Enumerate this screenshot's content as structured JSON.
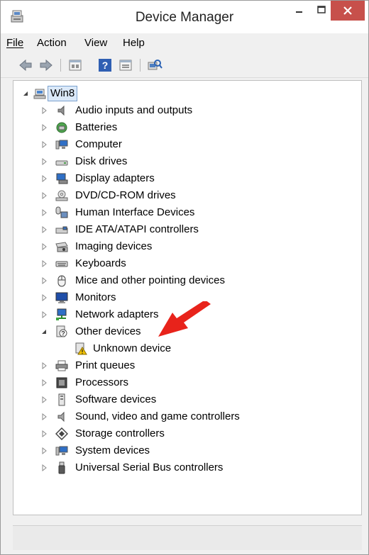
{
  "window": {
    "title": "Device Manager",
    "buttons": [
      "minimize",
      "maximize",
      "close"
    ]
  },
  "menu": [
    {
      "label": "File",
      "accel": "F"
    },
    {
      "label": "Action",
      "accel": "A"
    },
    {
      "label": "View",
      "accel": "V"
    },
    {
      "label": "Help",
      "accel": "H"
    }
  ],
  "toolbar": {
    "icons": [
      "back-arrow-icon",
      "forward-arrow-icon",
      "properties-icon",
      "help-icon",
      "device-view-icon",
      "scan-hardware-icon"
    ]
  },
  "tree": {
    "root": {
      "label": "Win8",
      "icon": "computer-icon",
      "expanded": true,
      "selected": true
    },
    "items": [
      {
        "label": "Audio inputs and outputs",
        "icon": "speaker-icon",
        "expanded": false
      },
      {
        "label": "Batteries",
        "icon": "battery-icon",
        "expanded": false
      },
      {
        "label": "Computer",
        "icon": "computer-icon",
        "expanded": false
      },
      {
        "label": "Disk drives",
        "icon": "disk-drive-icon",
        "expanded": false
      },
      {
        "label": "Display adapters",
        "icon": "display-adapter-icon",
        "expanded": false
      },
      {
        "label": "DVD/CD-ROM drives",
        "icon": "dvd-drive-icon",
        "expanded": false
      },
      {
        "label": "Human Interface Devices",
        "icon": "hid-icon",
        "expanded": false
      },
      {
        "label": "IDE ATA/ATAPI controllers",
        "icon": "ide-controller-icon",
        "expanded": false
      },
      {
        "label": "Imaging devices",
        "icon": "camera-icon",
        "expanded": false
      },
      {
        "label": "Keyboards",
        "icon": "keyboard-icon",
        "expanded": false
      },
      {
        "label": "Mice and other pointing devices",
        "icon": "mouse-icon",
        "expanded": false
      },
      {
        "label": "Monitors",
        "icon": "monitor-icon",
        "expanded": false
      },
      {
        "label": "Network adapters",
        "icon": "network-adapter-icon",
        "expanded": false
      },
      {
        "label": "Other devices",
        "icon": "other-devices-icon",
        "expanded": true,
        "children": [
          {
            "label": "Unknown device",
            "icon": "unknown-device-warning-icon"
          }
        ]
      },
      {
        "label": "Print queues",
        "icon": "printer-icon",
        "expanded": false
      },
      {
        "label": "Processors",
        "icon": "processor-icon",
        "expanded": false
      },
      {
        "label": "Software devices",
        "icon": "software-device-icon",
        "expanded": false
      },
      {
        "label": "Sound, video and game controllers",
        "icon": "sound-controller-icon",
        "expanded": false
      },
      {
        "label": "Storage controllers",
        "icon": "storage-controller-icon",
        "expanded": false
      },
      {
        "label": "System devices",
        "icon": "system-devices-icon",
        "expanded": false
      },
      {
        "label": "Universal Serial Bus controllers",
        "icon": "usb-icon",
        "expanded": false
      }
    ]
  },
  "annotation": {
    "icon": "red-arrow-icon",
    "color": "#e8231b"
  },
  "colors": {
    "close_button": "#c7504b",
    "selection_bg": "#dbe9f9",
    "selection_border": "#7da2ce"
  }
}
